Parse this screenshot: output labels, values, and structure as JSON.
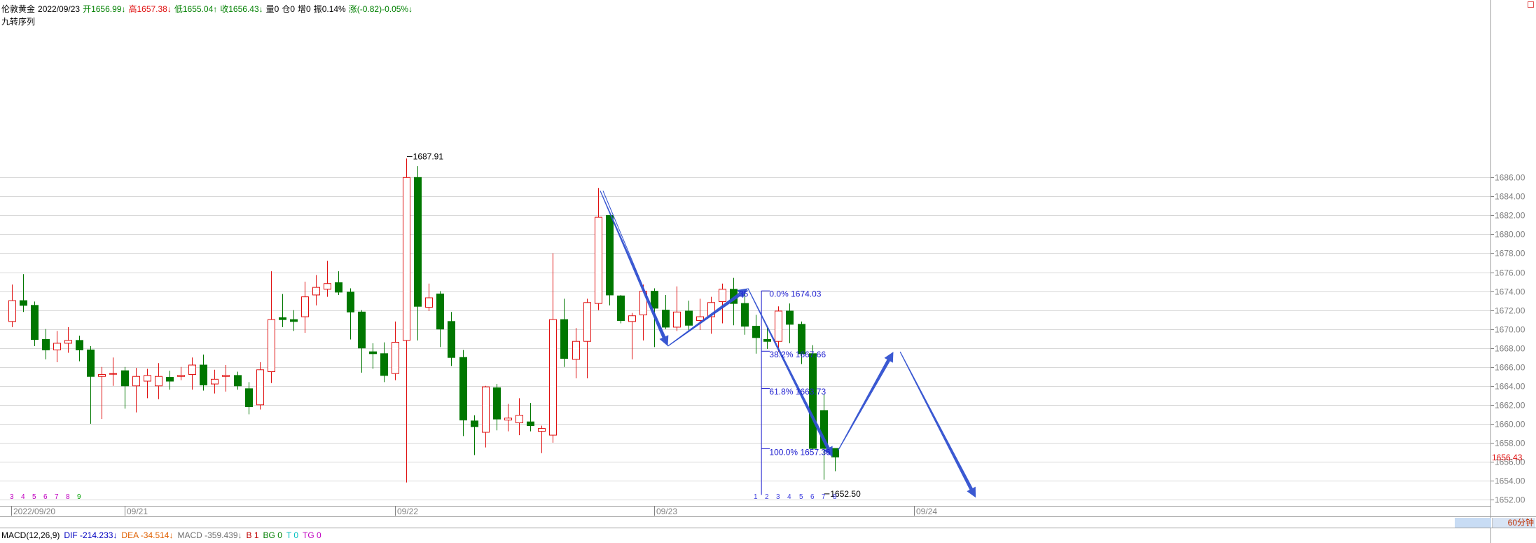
{
  "header": {
    "symbol": "伦敦黄金",
    "date": "2022/09/23",
    "open": "开1656.99↓",
    "high": "高1657.38↓",
    "low": "低1655.04↑",
    "close": "收1656.43↓",
    "volume": "量0",
    "position": "仓0",
    "increase": "增0",
    "amplitude": "振0.14%",
    "change": "涨(-0.82)-0.05%↓",
    "indicator": "九转序列"
  },
  "macd": {
    "name": "MACD(12,26,9)",
    "dif": "DIF -214.233↓",
    "dea": "DEA -34.514↓",
    "macd": "MACD -359.439↓",
    "b": "B 1",
    "bg": "BG 0",
    "t": "T 0",
    "tg": "TG 0"
  },
  "timeframe": "60分钟",
  "colors": {
    "up": "#e01010",
    "down": "#007700",
    "arrow": "#3050d0",
    "fib": "#2020d0",
    "grid": "#d8d8d8"
  },
  "chart_data": {
    "type": "candlestick",
    "ylim": [
      1651.5,
      1689.5
    ],
    "yticks": [
      "1652.00",
      "1654.00",
      "1656.00",
      "1658.00",
      "1660.00",
      "1662.00",
      "1664.00",
      "1666.00",
      "1668.00",
      "1670.00",
      "1672.00",
      "1674.00",
      "1676.00",
      "1678.00",
      "1680.00",
      "1682.00",
      "1684.00",
      "1686.00"
    ],
    "yvalues": [
      1652,
      1654,
      1656,
      1658,
      1660,
      1662,
      1664,
      1666,
      1668,
      1670,
      1672,
      1674,
      1676,
      1678,
      1680,
      1682,
      1684,
      1686
    ],
    "last_price": "1656.43",
    "xlabels": [
      {
        "i": 0,
        "text": "2022/09/20"
      },
      {
        "i": 10,
        "text": "09/21"
      },
      {
        "i": 34,
        "text": "09/22"
      },
      {
        "i": 57,
        "text": "09/23"
      },
      {
        "i": 80,
        "text": "09/24"
      }
    ],
    "candles": [
      [
        1670.8,
        1674.7,
        1670.2,
        1673.0
      ],
      [
        1673.0,
        1675.8,
        1671.8,
        1672.5
      ],
      [
        1672.5,
        1672.9,
        1668.2,
        1668.9
      ],
      [
        1668.9,
        1670.0,
        1666.8,
        1667.8
      ],
      [
        1667.8,
        1669.8,
        1666.5,
        1668.5
      ],
      [
        1668.5,
        1670.2,
        1667.5,
        1668.8
      ],
      [
        1668.8,
        1669.3,
        1666.6,
        1667.8
      ],
      [
        1667.8,
        1668.2,
        1660.0,
        1665.0
      ],
      [
        1665.0,
        1666.0,
        1660.5,
        1665.2
      ],
      [
        1665.3,
        1667.0,
        1664.0,
        1665.3
      ],
      [
        1665.6,
        1666.0,
        1661.6,
        1664.0
      ],
      [
        1664.0,
        1665.9,
        1661.2,
        1665.0
      ],
      [
        1664.5,
        1665.8,
        1662.7,
        1665.1
      ],
      [
        1664.0,
        1666.4,
        1662.6,
        1665.0
      ],
      [
        1664.9,
        1665.6,
        1663.6,
        1664.5
      ],
      [
        1665.0,
        1666.0,
        1664.6,
        1665.1
      ],
      [
        1665.2,
        1667.0,
        1663.6,
        1666.2
      ],
      [
        1666.2,
        1667.3,
        1663.5,
        1664.1
      ],
      [
        1664.2,
        1665.7,
        1663.2,
        1664.7
      ],
      [
        1665.0,
        1666.2,
        1663.4,
        1665.1
      ],
      [
        1665.1,
        1665.5,
        1663.6,
        1664.0
      ],
      [
        1663.7,
        1664.4,
        1661.0,
        1661.8
      ],
      [
        1662.0,
        1666.5,
        1661.5,
        1665.7
      ],
      [
        1665.5,
        1676.1,
        1664.3,
        1671.0
      ],
      [
        1671.2,
        1673.7,
        1670.2,
        1671.0
      ],
      [
        1671.0,
        1672.0,
        1669.8,
        1670.8
      ],
      [
        1671.3,
        1675.0,
        1669.6,
        1673.4
      ],
      [
        1673.6,
        1675.7,
        1672.5,
        1674.4
      ],
      [
        1674.2,
        1677.2,
        1673.4,
        1674.8
      ],
      [
        1674.9,
        1676.1,
        1673.6,
        1673.9
      ],
      [
        1673.9,
        1674.3,
        1668.9,
        1671.8
      ],
      [
        1671.8,
        1672.0,
        1665.4,
        1668.0
      ],
      [
        1667.6,
        1668.5,
        1665.8,
        1667.4
      ],
      [
        1667.4,
        1668.6,
        1664.4,
        1665.1
      ],
      [
        1665.3,
        1670.8,
        1664.6,
        1668.6
      ],
      [
        1668.8,
        1688.0,
        1653.8,
        1686.0
      ],
      [
        1686.0,
        1687.2,
        1668.8,
        1672.4
      ],
      [
        1672.3,
        1674.8,
        1671.9,
        1673.3
      ],
      [
        1673.7,
        1674.0,
        1668.1,
        1670.0
      ],
      [
        1670.8,
        1671.8,
        1666.1,
        1667.0
      ],
      [
        1667.0,
        1667.8,
        1658.7,
        1660.4
      ],
      [
        1660.3,
        1660.9,
        1656.7,
        1659.7
      ],
      [
        1659.1,
        1664.0,
        1657.5,
        1663.9
      ],
      [
        1663.8,
        1664.2,
        1659.3,
        1660.5
      ],
      [
        1660.4,
        1662.1,
        1659.2,
        1660.6
      ],
      [
        1660.1,
        1662.7,
        1658.8,
        1660.9
      ],
      [
        1660.2,
        1662.2,
        1659.2,
        1659.8
      ],
      [
        1659.2,
        1659.8,
        1656.9,
        1659.5
      ],
      [
        1658.8,
        1678.0,
        1658.0,
        1671.0
      ],
      [
        1671.0,
        1673.2,
        1666.0,
        1666.9
      ],
      [
        1666.8,
        1670.1,
        1664.8,
        1668.7
      ],
      [
        1668.7,
        1673.2,
        1664.8,
        1672.8
      ],
      [
        1672.7,
        1684.9,
        1672.0,
        1681.8
      ],
      [
        1682.0,
        1682.0,
        1672.5,
        1673.6
      ],
      [
        1673.5,
        1673.6,
        1670.6,
        1670.9
      ],
      [
        1670.8,
        1671.7,
        1666.8,
        1671.4
      ],
      [
        1671.5,
        1674.7,
        1668.8,
        1674.0
      ],
      [
        1674.0,
        1674.3,
        1668.1,
        1672.2
      ],
      [
        1672.0,
        1673.6,
        1670.0,
        1670.2
      ],
      [
        1670.2,
        1674.5,
        1669.8,
        1671.8
      ],
      [
        1671.9,
        1673.0,
        1669.8,
        1670.4
      ],
      [
        1670.9,
        1673.2,
        1669.9,
        1671.3
      ],
      [
        1671.3,
        1673.4,
        1669.5,
        1672.8
      ],
      [
        1672.9,
        1674.8,
        1670.6,
        1674.2
      ],
      [
        1674.2,
        1675.4,
        1670.4,
        1672.7
      ],
      [
        1672.7,
        1673.7,
        1669.4,
        1670.3
      ],
      [
        1670.3,
        1671.5,
        1667.4,
        1669.1
      ],
      [
        1668.9,
        1670.1,
        1667.9,
        1668.7
      ],
      [
        1668.7,
        1672.4,
        1667.6,
        1671.9
      ],
      [
        1671.9,
        1672.7,
        1668.5,
        1670.5
      ],
      [
        1670.5,
        1670.8,
        1666.3,
        1667.4
      ],
      [
        1667.4,
        1668.3,
        1657.3,
        1657.4
      ],
      [
        1661.4,
        1663.1,
        1654.1,
        1657.4
      ],
      [
        1657.4,
        1657.4,
        1655.0,
        1656.5
      ]
    ],
    "labels": [
      {
        "text": "1687.91",
        "i": 35.6,
        "v": 1688.2
      },
      {
        "text": "1652.50",
        "i": 72.6,
        "v": 1652.6
      },
      {
        "text": "0.0% 1674.03",
        "i": 67.2,
        "v": 1673.7
      },
      {
        "text": "38.2%  1667.66",
        "i": 67.2,
        "v": 1667.3
      },
      {
        "text": "61.8% 1663.73",
        "i": 67.2,
        "v": 1663.4
      },
      {
        "text": "100.0% 1657.36",
        "i": 67.2,
        "v": 1657.0
      },
      {
        "text": "35",
        "i": 64.5,
        "v": 1673.7
      }
    ],
    "fib": {
      "i": 66.5,
      "top": 1674.03,
      "bottom": 1652.5,
      "levels": [
        1674.03,
        1667.66,
        1663.73,
        1657.36
      ]
    },
    "nine_seq": [
      {
        "i": 0,
        "n": "3"
      },
      {
        "i": 1,
        "n": "4"
      },
      {
        "i": 2,
        "n": "5"
      },
      {
        "i": 3,
        "n": "6"
      },
      {
        "i": 4,
        "n": "7"
      },
      {
        "i": 5,
        "n": "8"
      },
      {
        "i": 6,
        "n": "9"
      },
      {
        "i": 66,
        "n": "1"
      },
      {
        "i": 67,
        "n": "2"
      },
      {
        "i": 68,
        "n": "3"
      },
      {
        "i": 69,
        "n": "4"
      },
      {
        "i": 70,
        "n": "5"
      },
      {
        "i": 71,
        "n": "6"
      },
      {
        "i": 72,
        "n": "7"
      },
      {
        "i": 73,
        "n": "8"
      }
    ],
    "arrows": [
      [
        [
          52.2,
          1684.6
        ],
        [
          58.2,
          1668.2
        ]
      ],
      [
        [
          58.2,
          1668.2
        ],
        [
          65.3,
          1674.3
        ]
      ],
      [
        [
          65.3,
          1674.3
        ],
        [
          72.8,
          1656.5
        ]
      ],
      [
        [
          73.3,
          1657.2
        ],
        [
          78.2,
          1667.6
        ]
      ],
      [
        [
          78.8,
          1667.6
        ],
        [
          85.5,
          1652.2
        ]
      ]
    ]
  }
}
